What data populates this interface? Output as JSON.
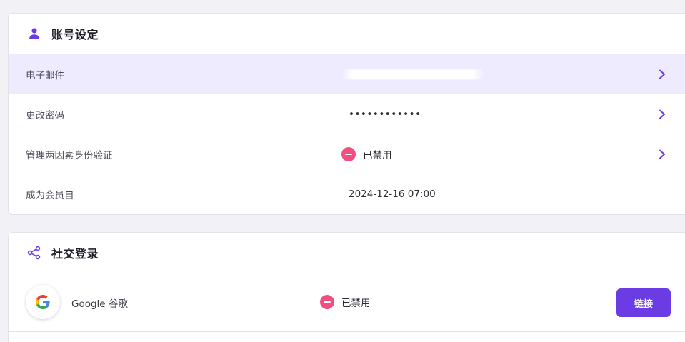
{
  "account": {
    "title": "账号设定",
    "icon": "user-icon",
    "rows": [
      {
        "label": "电子邮件"
      },
      {
        "label": "更改密码",
        "value": "••••••••••••"
      },
      {
        "label": "管理两因素身份验证",
        "status": "已禁用"
      },
      {
        "label": "成为会员自",
        "value": "2024-12-16 07:00"
      }
    ]
  },
  "social": {
    "title": "社交登录",
    "icon": "share-icon",
    "providers": [
      {
        "name": "Google  谷歌",
        "status": "已禁用",
        "button": "链接",
        "icon": "google-logo-icon"
      }
    ]
  },
  "colors": {
    "accent": "#6b3ce4",
    "highlight_row": "#efebff",
    "status_disabled": "#f24e82",
    "background": "#f2f2f6"
  }
}
